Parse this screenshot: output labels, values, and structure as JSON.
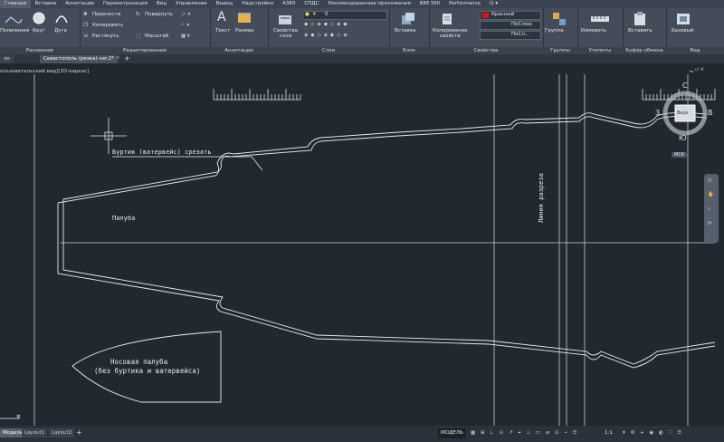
{
  "menu": {
    "tabs": [
      "Главная",
      "Вставка",
      "Аннотации",
      "Параметризация",
      "Вид",
      "Управление",
      "Вывод",
      "Надстройки",
      "A360",
      "СПДС",
      "Рекомендованные приложения",
      "BIM 360",
      "Performance"
    ],
    "active_index": 0
  },
  "ribbon": {
    "draw": {
      "title": "Рисование",
      "polyline": "Полилиния",
      "circle": "Круг",
      "arc": "Дуга"
    },
    "modify": {
      "title": "Редактирование",
      "move": "Перенести",
      "rotate": "Повернуть",
      "copy": "Копировать",
      "stretch": "Растянуть",
      "scale": "Масштаб"
    },
    "annot": {
      "title": "Аннотации",
      "text": "Текст",
      "dim": "Размер"
    },
    "layers": {
      "title": "Слои",
      "props": "Свойства\nслоя",
      "current": "0"
    },
    "block": {
      "title": "Блок",
      "insert": "Вставка"
    },
    "props": {
      "title": "Свойства",
      "copy": "Копирование\nсвойств",
      "color": "Красный",
      "color_hex": "#e01010",
      "lw": "ПоСлою",
      "lt": "ПоСл..."
    },
    "groups": {
      "title": "Группы",
      "group": "Группа"
    },
    "util": {
      "title": "Утилиты",
      "measure": "Измерить"
    },
    "clip": {
      "title": "Буфер обмена",
      "paste": "Вставить"
    },
    "view": {
      "title": "Вид",
      "base": "Базовый"
    }
  },
  "doc": {
    "tab1": "ло",
    "tab2": "Севастополь (резка)-ver.2*",
    "viewlabel": "ользовательский вид][2D-каркас]"
  },
  "drawing": {
    "label_bortik": "Буртик (ватервейс) срезать",
    "label_paluba": "Палуба",
    "label_cut": "Линия разреза",
    "label_nos1": "Носовая палуба",
    "label_nos2": "(без буртика и ватервейса)"
  },
  "viewcube": {
    "top": "С",
    "left": "З",
    "right": "В",
    "bottom": "Ю",
    "face": "Верх",
    "wcs": "МСК"
  },
  "status": {
    "layouts": [
      "Модель",
      "Layout1",
      "Layout2"
    ],
    "model": "МОДЕЛЬ",
    "scale": "1:1"
  }
}
